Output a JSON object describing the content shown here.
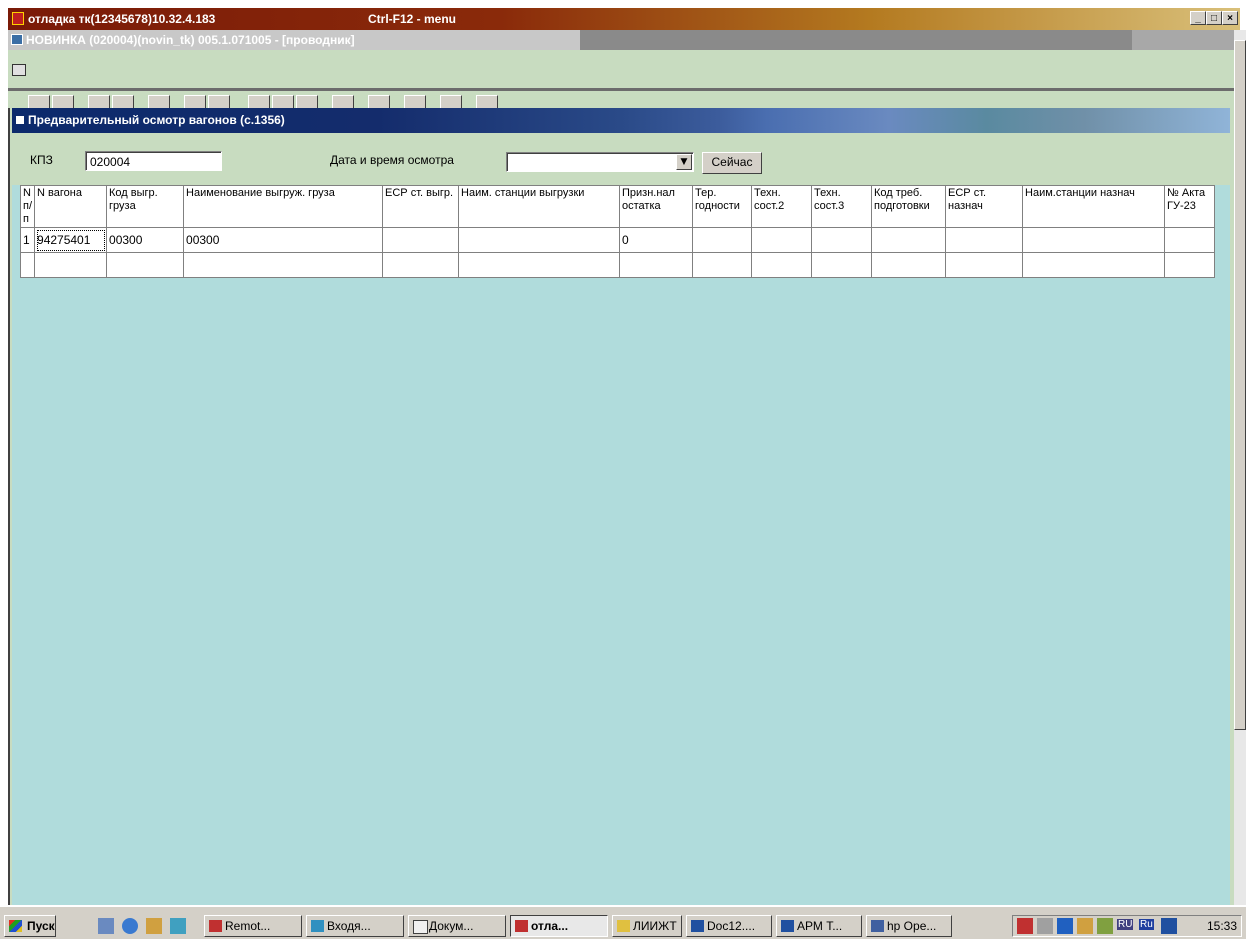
{
  "window": {
    "title": "отладка тк(12345678)10.32.4.183",
    "hotkey_hint": "Ctrl-F12 - menu",
    "min": "_",
    "max": "□",
    "close": "×"
  },
  "app": {
    "subtitle": "НОВИНКА (020004)(novin_tk) 005.1.071005 - [проводник]"
  },
  "panel": {
    "title": "Предварительный осмотр вагонов  (с.1356)"
  },
  "form": {
    "kpz_label": "КПЗ",
    "kpz_value": "020004",
    "date_label": "Дата и время осмотра",
    "date_value": "",
    "now_button": "Сейчас"
  },
  "grid": {
    "columns": [
      "N п/п",
      "N вагона",
      "Код выгр. груза",
      "Наименование выгруж. груза",
      "ЕСР ст. выгр.",
      "Наим. станции выгрузки",
      "Призн.нал остатка",
      "Тер. годности",
      "Техн. сост.2",
      "Техн. сост.3",
      "Код треб. подготовки",
      "ЕСР ст. назнач",
      "Наим.станции назнач",
      "№ Акта ГУ-23"
    ],
    "rows": [
      [
        "1",
        "94275401",
        "00300",
        "00300",
        "",
        "",
        "0",
        "",
        "",
        "",
        "",
        "",
        "",
        ""
      ],
      [
        "",
        "",
        "",
        "",
        "",
        "",
        "",
        "",
        "",
        "",
        "",
        "",
        "",
        ""
      ]
    ]
  },
  "taskbar": {
    "start": "Пуск",
    "tasks": [
      "Remot...",
      "Входя...",
      "Докум...",
      "отла...",
      "ЛИИЖТ",
      "Doc12....",
      "АРМ Т...",
      "hp Ope..."
    ],
    "lang1": "RU",
    "lang2": "Ru",
    "clock": "15:33"
  }
}
